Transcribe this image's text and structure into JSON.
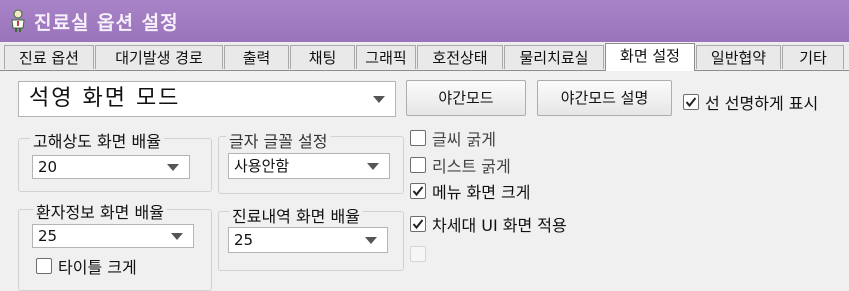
{
  "window": {
    "title": "진료실 옵션 설정",
    "icon": "doctor-figure-icon",
    "title_bar_color": "#9f79c0"
  },
  "tabs": [
    {
      "label": "진료 옵션",
      "active": false
    },
    {
      "label": "대기발생 경로",
      "active": false
    },
    {
      "label": "출력",
      "active": false
    },
    {
      "label": "채팅",
      "active": false
    },
    {
      "label": "그래픽",
      "active": false
    },
    {
      "label": "호전상태",
      "active": false
    },
    {
      "label": "물리치료실",
      "active": false
    },
    {
      "label": "화면 설정",
      "active": true
    },
    {
      "label": "일반협약",
      "active": false
    },
    {
      "label": "기타",
      "active": false
    }
  ],
  "screen_mode": {
    "selected": "석영 화면 모드",
    "night_mode_button": "야간모드",
    "night_mode_help_button": "야간모드 설명",
    "sharp_line_label": "선 선명하게 표시",
    "sharp_line_checked": true
  },
  "hires_scale": {
    "label": "고해상도 화면 배율",
    "value": "20"
  },
  "font_setting": {
    "label": "글자 글꼴 설정",
    "value": "사용안함"
  },
  "patient_info_scale": {
    "label": "환자정보 화면 배율",
    "value": "25",
    "title_large_label": "타이틀 크게",
    "title_large_checked": false
  },
  "history_scale": {
    "label": "진료내역 화면 배율",
    "value": "25"
  },
  "options": [
    {
      "label": "글씨 굵게",
      "checked": false,
      "disabled": false
    },
    {
      "label": "리스트 굵게",
      "checked": false,
      "disabled": false
    },
    {
      "label": "메뉴 화면 크게",
      "checked": true,
      "disabled": false
    },
    {
      "label": "차세대 UI 화면 적용",
      "checked": true,
      "disabled": false
    },
    {
      "label": "",
      "checked": false,
      "disabled": true
    }
  ]
}
